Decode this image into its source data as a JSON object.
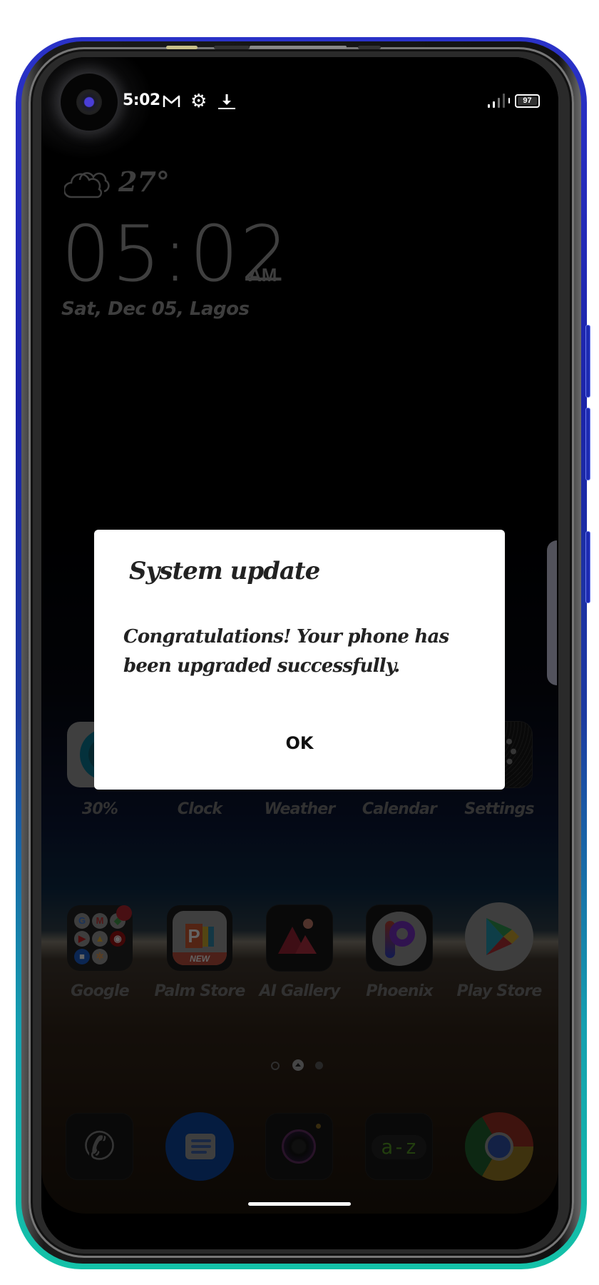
{
  "status_bar": {
    "time": "5:02",
    "left_icons": [
      "gmail-icon",
      "gear-icon",
      "download-icon"
    ],
    "battery_level": "97",
    "signal": "signal-bars"
  },
  "clock_widget": {
    "weather_icon": "cloud-icon",
    "temperature": "27°",
    "time": "05:02",
    "ampm": "AM",
    "date": "Sat, Dec 05, Lagos"
  },
  "app_row_1": [
    {
      "label": "30%",
      "icon": "cleaner-icon"
    },
    {
      "label": "Clock",
      "icon": "clock-icon"
    },
    {
      "label": "Weather",
      "icon": "weather-icon"
    },
    {
      "label": "Calendar",
      "icon": "calendar-icon"
    },
    {
      "label": "Settings",
      "icon": "settings-gear-icon"
    }
  ],
  "app_row_2": [
    {
      "label": "Google",
      "icon": "google-folder-icon"
    },
    {
      "label": "Palm Store",
      "icon": "palm-store-icon",
      "badge": "NEW"
    },
    {
      "label": "AI Gallery",
      "icon": "gallery-icon"
    },
    {
      "label": "Phoenix",
      "icon": "phoenix-icon"
    },
    {
      "label": "Play Store",
      "icon": "play-store-icon"
    }
  ],
  "google_folder_apps": [
    "G",
    "M",
    "Maps",
    "YouTube",
    "Drive",
    "YT Music",
    "Duo",
    "Photos"
  ],
  "page_indicator": {
    "pages": 3,
    "current": 2,
    "first_is_search": true
  },
  "dock": [
    {
      "name": "Phone",
      "icon": "phone-icon"
    },
    {
      "name": "Messages",
      "icon": "messages-icon"
    },
    {
      "name": "Camera",
      "icon": "camera-icon"
    },
    {
      "name": "Dictionary",
      "icon": "a-z-icon",
      "text": "a-z"
    },
    {
      "name": "Chrome",
      "icon": "chrome-icon"
    }
  ],
  "dialog": {
    "title": "System update",
    "message": "Congratulations! Your phone has been upgraded successfully.",
    "ok_label": "OK"
  },
  "colors": {
    "frame_top": "#2a32c8",
    "frame_bottom": "#14c2a8",
    "dialog_bg": "#ffffff",
    "messages_blue": "#0d3f8f"
  }
}
